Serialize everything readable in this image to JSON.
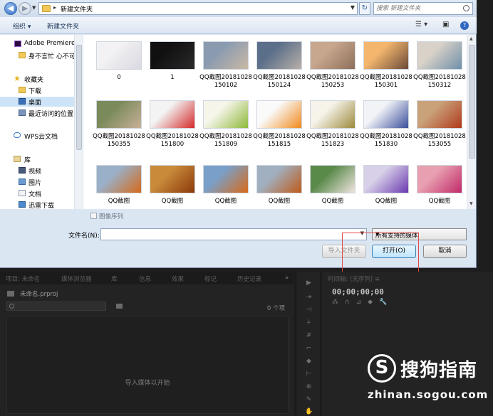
{
  "dialog": {
    "address": {
      "path": "新建文件夹",
      "separator": "▸"
    },
    "search": {
      "placeholder": "搜索 新建文件夹"
    },
    "toolbar": {
      "organize": "组织 ▾",
      "new_folder": "新建文件夹"
    },
    "nav": [
      {
        "label": "Adobe Premiere",
        "icon": "premiere-icon"
      },
      {
        "label": "身不言忙 心不可",
        "icon": "folder-icon"
      },
      {
        "label": "收藏夹",
        "icon": "star-icon"
      },
      {
        "label": "下载",
        "icon": "download-folder-icon"
      },
      {
        "label": "桌面",
        "icon": "desktop-icon",
        "selected": true
      },
      {
        "label": "最近访问的位置",
        "icon": "recent-places-icon"
      },
      {
        "label": "WPS云文档",
        "icon": "cloud-icon"
      },
      {
        "label": "库",
        "icon": "library-icon"
      },
      {
        "label": "视频",
        "icon": "video-library-icon"
      },
      {
        "label": "图片",
        "icon": "picture-library-icon"
      },
      {
        "label": "文档",
        "icon": "document-library-icon"
      },
      {
        "label": "迅雷下载",
        "icon": "xunlei-download-icon"
      }
    ],
    "files": [
      {
        "name": "0",
        "colors": [
          "#f2f2f4",
          "#d9d9e0"
        ]
      },
      {
        "name": "1",
        "colors": [
          "#111111",
          "#2a2a2a"
        ]
      },
      {
        "name": "QQ截图20181028150102",
        "colors": [
          "#8a9bb0",
          "#c9b9a5"
        ]
      },
      {
        "name": "QQ截图20181028150124",
        "colors": [
          "#5c6f8a",
          "#b8b0a8"
        ]
      },
      {
        "name": "QQ截图20181028150253",
        "colors": [
          "#c7a78e",
          "#8e6f5a"
        ]
      },
      {
        "name": "QQ截图20181028150301",
        "colors": [
          "#f4b66d",
          "#6a4a3a"
        ]
      },
      {
        "name": "QQ截图20181028150312",
        "colors": [
          "#d9d2c8",
          "#6f8fa8"
        ]
      },
      {
        "name": "QQ截图20181028150355",
        "colors": [
          "#7a8a5a",
          "#c9b09a"
        ]
      },
      {
        "name": "QQ截图20181028151800",
        "colors": [
          "#f3f3f3",
          "#d42a2a"
        ]
      },
      {
        "name": "QQ截图20181028151809",
        "colors": [
          "#f5f5ea",
          "#8fb83a"
        ]
      },
      {
        "name": "QQ截图20181028151815",
        "colors": [
          "#fafafa",
          "#f08a1c"
        ]
      },
      {
        "name": "QQ截图20181028151823",
        "colors": [
          "#f5f3ea",
          "#9c8a3c"
        ]
      },
      {
        "name": "QQ截图20181028151830",
        "colors": [
          "#f2f3f7",
          "#3a4f9a"
        ]
      },
      {
        "name": "QQ截图20181028153055",
        "colors": [
          "#c9a27a",
          "#b03a1a"
        ]
      },
      {
        "name": "QQ截图",
        "colors": [
          "#9ab0c9",
          "#d46a1a"
        ]
      },
      {
        "name": "QQ截图",
        "colors": [
          "#c98a3a",
          "#8a3a0a"
        ]
      },
      {
        "name": "QQ截图",
        "colors": [
          "#7aa0c9",
          "#d86a1a"
        ]
      },
      {
        "name": "QQ截图",
        "colors": [
          "#a0b0c0",
          "#c05a1a"
        ]
      },
      {
        "name": "QQ截图",
        "colors": [
          "#5a8a4a",
          "#f0e4e0"
        ]
      },
      {
        "name": "QQ截图",
        "colors": [
          "#d8d0e8",
          "#6a3ab0"
        ]
      },
      {
        "name": "QQ截图",
        "colors": [
          "#e8a0b0",
          "#c02a6a"
        ]
      }
    ],
    "image_sequence_label": "图像序列",
    "filename_label": "文件名(N):",
    "filename_value": "",
    "filetype_value": "所有支持的媒体",
    "buttons": {
      "import_folder": "导入文件夹",
      "open": "打开(O)",
      "cancel": "取消"
    }
  },
  "premiere": {
    "project_tabs": [
      "项目: 未命名",
      "媒体浏览器",
      "库",
      "信息",
      "效果",
      "标记",
      "历史记录"
    ],
    "project_name": "未命名.prproj",
    "item_count": "0 个项",
    "drop_hint": "导入媒体以开始",
    "timeline_tab": "时间轴: (无序列) ≡",
    "timecode": "00;00;00;00"
  },
  "watermark": {
    "brand": "搜狗指南",
    "url": "zhinan.sogou.com"
  }
}
